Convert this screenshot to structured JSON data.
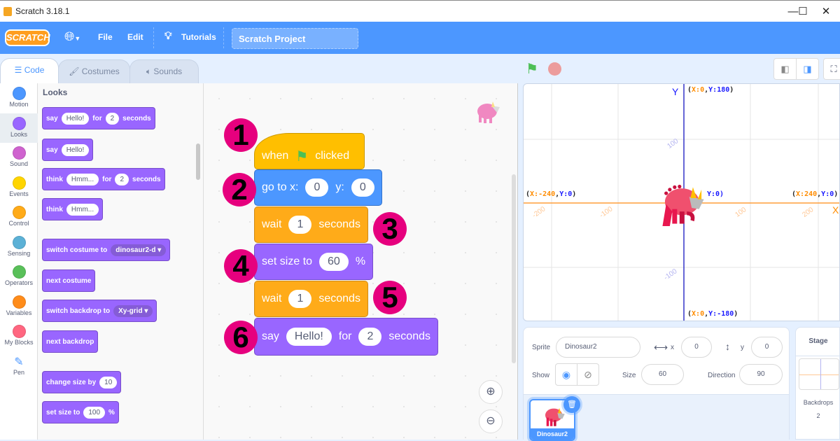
{
  "window": {
    "title": "Scratch 3.18.1",
    "controls": [
      "—",
      "☐",
      "✕"
    ]
  },
  "menubar": {
    "logo": "SCRATCH",
    "items": [
      "File",
      "Edit"
    ],
    "tutorials": "Tutorials",
    "project_title": "Scratch Project"
  },
  "tabs": [
    {
      "label": "Code",
      "active": true
    },
    {
      "label": "Costumes",
      "active": false
    },
    {
      "label": "Sounds",
      "active": false
    }
  ],
  "categories": [
    {
      "label": "Motion",
      "color": "#4c97ff"
    },
    {
      "label": "Looks",
      "color": "#9966ff",
      "active": true
    },
    {
      "label": "Sound",
      "color": "#cf63cf"
    },
    {
      "label": "Events",
      "color": "#ffd500"
    },
    {
      "label": "Control",
      "color": "#ffab19"
    },
    {
      "label": "Sensing",
      "color": "#5cb1d6"
    },
    {
      "label": "Operators",
      "color": "#59c059"
    },
    {
      "label": "Variables",
      "color": "#ff8c1a"
    },
    {
      "label": "My Blocks",
      "color": "#ff6680"
    },
    {
      "label": "Pen",
      "color": ""
    }
  ],
  "palette": {
    "title": "Looks",
    "blocks": [
      {
        "parts": [
          "say",
          "@Hello!",
          "for",
          "@2",
          "seconds"
        ]
      },
      {
        "parts": [
          "say",
          "@Hello!"
        ]
      },
      {
        "parts": [
          "think",
          "@Hmm...",
          "for",
          "@2",
          "seconds"
        ]
      },
      {
        "parts": [
          "think",
          "@Hmm..."
        ]
      },
      {
        "parts": [
          "switch costume to",
          "#dinosaur2-d ▾"
        ]
      },
      {
        "parts": [
          "next costume"
        ]
      },
      {
        "parts": [
          "switch backdrop to",
          "#Xy-grid ▾"
        ]
      },
      {
        "parts": [
          "next backdrop"
        ]
      },
      {
        "parts": [
          "change size by",
          "@10"
        ]
      },
      {
        "parts": [
          "set size to",
          "@100",
          "%"
        ]
      }
    ]
  },
  "script": {
    "hat": {
      "when": "when",
      "clicked": "clicked"
    },
    "blocks": [
      {
        "num": "2",
        "color": "#4c97ff",
        "border": "#3373cc",
        "parts": [
          "go to x:",
          "@0",
          "y:",
          "@0"
        ]
      },
      {
        "num": "3",
        "color": "#ffab19",
        "border": "#cf8b17",
        "parts": [
          "wait",
          "@1",
          "seconds"
        ]
      },
      {
        "num": "4",
        "color": "#9966ff",
        "border": "#774dcb",
        "parts": [
          "set size to",
          "@60",
          "%"
        ]
      },
      {
        "num": "5",
        "color": "#ffab19",
        "border": "#cf8b17",
        "parts": [
          "wait",
          "@1",
          "seconds"
        ]
      },
      {
        "num": "6",
        "color": "#9966ff",
        "border": "#774dcb",
        "parts": [
          "say",
          "@Hello!",
          "for",
          "@2",
          "seconds"
        ]
      }
    ],
    "hat_num": "1"
  },
  "stage": {
    "y_axis_label": "Y",
    "x_axis_label": "X",
    "coords": {
      "top": {
        "x": "0",
        "y": "180"
      },
      "bottom": {
        "x": "0",
        "y": "-180"
      },
      "left": {
        "x": "-240",
        "y": "0"
      },
      "right": {
        "x": "240",
        "y": "0"
      },
      "center_partial": "Y:0)"
    },
    "x_ticks": [
      "-200",
      "-100",
      "100",
      "200"
    ],
    "y_ticks": [
      "100",
      "-100"
    ]
  },
  "sprite_info": {
    "sprite_label": "Sprite",
    "sprite_name": "Dinosaur2",
    "x_label": "x",
    "x": "0",
    "y_label": "y",
    "y": "0",
    "show_label": "Show",
    "size_label": "Size",
    "size": "60",
    "direction_label": "Direction",
    "direction": "90"
  },
  "sprites": [
    {
      "name": "Dinosaur2",
      "selected": true
    }
  ],
  "stage_pane": {
    "title": "Stage",
    "backdrops_label": "Backdrops",
    "backdrops_count": "2"
  }
}
